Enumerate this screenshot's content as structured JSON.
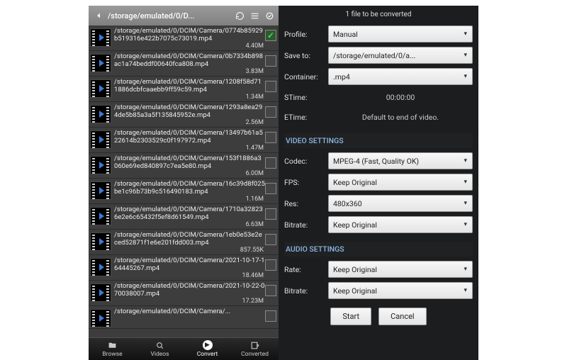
{
  "left": {
    "path": "/storage/emulated/0/D...",
    "files": [
      {
        "name": "/storage/emulated/0/DCIM/Camera/0774b85929b519316e422b7075c73019.mp4",
        "size": "4.40M",
        "checked": true
      },
      {
        "name": "/storage/emulated/0/DCIM/Camera/0b7334b898ac1a74beddf00640fca808.mp4",
        "size": "3.83M",
        "checked": false
      },
      {
        "name": "/storage/emulated/0/DCIM/Camera/1208f58d711886dcbfcaaebb9ff59c59.mp4",
        "size": "1.34M",
        "checked": false
      },
      {
        "name": "/storage/emulated/0/DCIM/Camera/1293a8ea294de5b85a3a5f135845952e.mp4",
        "size": "2.56M",
        "checked": false
      },
      {
        "name": "/storage/emulated/0/DCIM/Camera/13497b61a522614b2303529c0f197972.mp4",
        "size": "1.47M",
        "checked": false
      },
      {
        "name": "/storage/emulated/0/DCIM/Camera/153f1886a3060e69ed840897c7ea5e80.mp4",
        "size": "6.00M",
        "checked": false
      },
      {
        "name": "/storage/emulated/0/DCIM/Camera/16c39d8f025be1c96b73b9c516490183.mp4",
        "size": "1.16M",
        "checked": false
      },
      {
        "name": "/storage/emulated/0/DCIM/Camera/1710a328236e2e6c65432f5ef8d61549.mp4",
        "size": "6.63M",
        "checked": false
      },
      {
        "name": "/storage/emulated/0/DCIM/Camera/1eb0e53e2eced52871f1e6e201fdd003.mp4",
        "size": "857.55K",
        "checked": false
      },
      {
        "name": "/storage/emulated/0/DCIM/Camera/2021-10-17-164445267.mp4",
        "size": "18.46M",
        "checked": false
      },
      {
        "name": "/storage/emulated/0/DCIM/Camera/2021-10-22-070038007.mp4",
        "size": "17.23M",
        "checked": false
      },
      {
        "name": "/storage/emulated/0/DCIM/Camera/...",
        "size": "",
        "checked": false
      }
    ],
    "tabs": [
      "Browse",
      "Videos",
      "Convert",
      "Converted"
    ]
  },
  "right": {
    "heading": "1  file to be converted",
    "profile_label": "Profile:",
    "profile_value": "Manual",
    "saveto_label": "Save to:",
    "saveto_value": "/storage/emulated/0/a...",
    "container_label": "Container:",
    "container_value": ".mp4",
    "stime_label": "STime:",
    "stime_value": "00:00:00",
    "etime_label": "ETime:",
    "etime_value": "Default to end of video.",
    "video_section": "VIDEO SETTINGS",
    "codec_label": "Codec:",
    "codec_value": "MPEG-4 (Fast, Quality OK)",
    "fps_label": "FPS:",
    "fps_value": "Keep Original",
    "res_label": "Res:",
    "res_value": "480x360",
    "vbitrate_label": "Bitrate:",
    "vbitrate_value": "Keep Original",
    "audio_section": "AUDIO SETTINGS",
    "rate_label": "Rate:",
    "rate_value": "Keep Original",
    "abitrate_label": "Bitrate:",
    "abitrate_value": "Keep Original",
    "start": "Start",
    "cancel": "Cancel"
  }
}
